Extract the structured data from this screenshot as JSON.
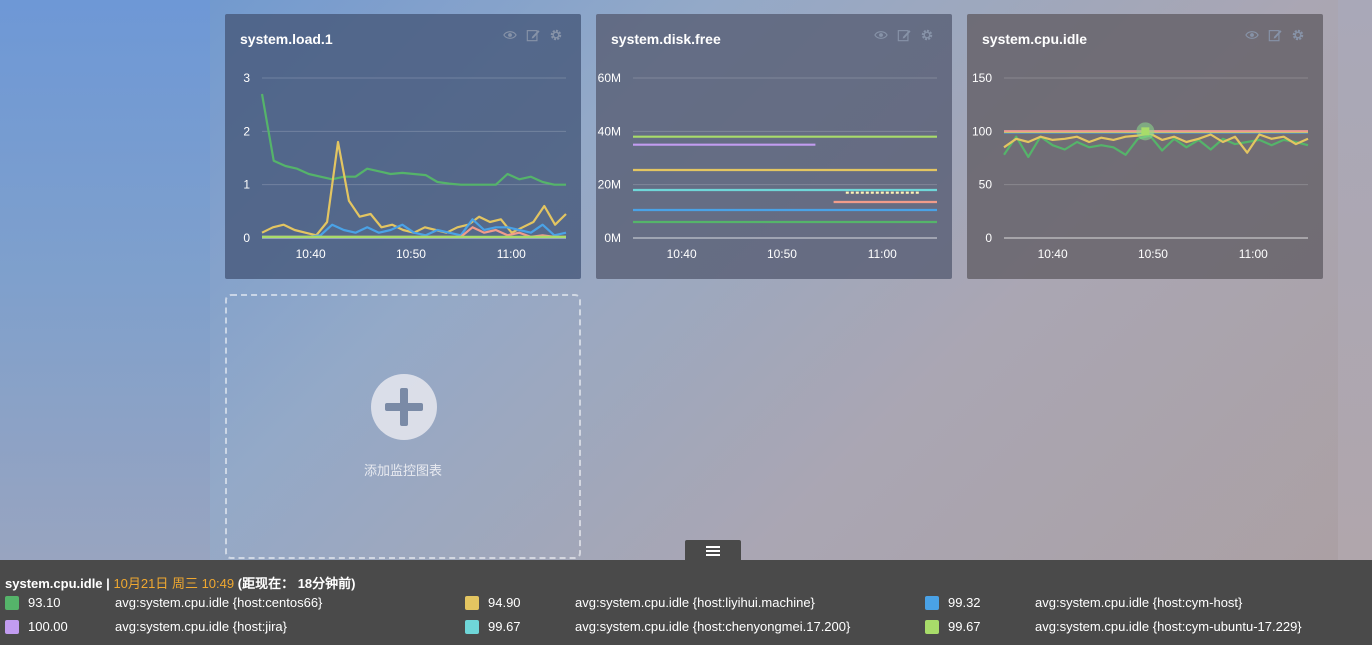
{
  "cards": [
    {
      "title": "system.load.1",
      "chart_data": {
        "type": "line",
        "ylim": [
          0,
          3
        ],
        "yticks": [
          "0",
          "1",
          "2",
          "3"
        ],
        "xticks": [
          "10:40",
          "10:50",
          "11:00"
        ],
        "series": [
          {
            "color": "#55b46a",
            "values": [
              2.7,
              1.45,
              1.35,
              1.3,
              1.2,
              1.15,
              1.1,
              1.15,
              1.15,
              1.3,
              1.25,
              1.2,
              1.22,
              1.2,
              1.18,
              1.05,
              1.02,
              1.0,
              1.0,
              1.0,
              1.0,
              1.2,
              1.1,
              1.15,
              1.05,
              1.0,
              1.0
            ]
          },
          {
            "color": "#e3c561",
            "values": [
              0.1,
              0.2,
              0.25,
              0.15,
              0.1,
              0.05,
              0.3,
              1.8,
              0.7,
              0.4,
              0.45,
              0.2,
              0.25,
              0.15,
              0.1,
              0.2,
              0.15,
              0.1,
              0.2,
              0.25,
              0.4,
              0.3,
              0.35,
              0.1,
              0.2,
              0.3,
              0.6,
              0.25,
              0.45
            ]
          },
          {
            "color": "#4aa2e6",
            "values": [
              0.02,
              0.02,
              0.02,
              0.02,
              0.02,
              0.05,
              0.25,
              0.15,
              0.1,
              0.2,
              0.1,
              0.15,
              0.25,
              0.1,
              0.05,
              0.15,
              0.1,
              0.05,
              0.35,
              0.15,
              0.2,
              0.2,
              0.15,
              0.1,
              0.25,
              0.05,
              0.1
            ]
          },
          {
            "color": "#f19c8a",
            "values": [
              0.02,
              0.02,
              0.02,
              0.02,
              0.02,
              0.02,
              0.02,
              0.02,
              0.02,
              0.02,
              0.02,
              0.02,
              0.02,
              0.02,
              0.02,
              0.02,
              0.02,
              0.02,
              0.2,
              0.1,
              0.15,
              0.05,
              0.1,
              0.02,
              0.05,
              0.02,
              0.02
            ]
          },
          {
            "color": "#a8dc6a",
            "values": [
              0.02,
              0.02,
              0.02,
              0.02,
              0.02,
              0.02,
              0.02,
              0.02,
              0.02,
              0.02,
              0.02,
              0.02,
              0.02,
              0.02,
              0.02,
              0.02,
              0.02,
              0.02,
              0.02,
              0.02,
              0.02,
              0.02,
              0.02,
              0.02,
              0.02,
              0.02,
              0.02
            ]
          }
        ]
      }
    },
    {
      "title": "system.disk.free",
      "chart_data": {
        "type": "line",
        "ylim": [
          0,
          60
        ],
        "yticks": [
          "0M",
          "20M",
          "40M",
          "60M"
        ],
        "xticks": [
          "10:40",
          "10:50",
          "11:00"
        ],
        "series": [
          {
            "color": "#a8dc6a",
            "values": [
              38,
              38
            ]
          },
          {
            "color": "#c29cf0",
            "values": [
              35,
              35
            ],
            "extent": 0.6
          },
          {
            "color": "#e3c561",
            "values": [
              25.5,
              25.5
            ]
          },
          {
            "color": "#6fd6d8",
            "values": [
              18,
              18
            ]
          },
          {
            "color": "#4aa2e6",
            "values": [
              10.5,
              10.5
            ]
          },
          {
            "color": "#55b46a",
            "values": [
              6,
              6
            ]
          },
          {
            "color": "#fff5b8",
            "values": [
              17,
              17
            ],
            "start": 0.7,
            "extent": 0.94,
            "dotted": true
          },
          {
            "color": "#f19c8a",
            "values": [
              13.5,
              13.5
            ],
            "start": 0.66
          }
        ]
      }
    },
    {
      "title": "system.cpu.idle",
      "chart_data": {
        "type": "line",
        "ylim": [
          0,
          150
        ],
        "yticks": [
          "0",
          "50",
          "100",
          "150"
        ],
        "xticks": [
          "10:40",
          "10:50",
          "11:00"
        ],
        "series": [
          {
            "color": "#55b46a",
            "values": [
              78,
              95,
              76,
              95,
              87,
              83,
              90,
              85,
              87,
              85,
              78,
              93,
              96,
              82,
              93,
              85,
              92,
              83,
              93,
              88,
              90,
              92,
              87,
              92,
              90,
              87
            ]
          },
          {
            "color": "#e3c561",
            "values": [
              85,
              93,
              90,
              95,
              92,
              93,
              95,
              90,
              94,
              92,
              95,
              96,
              98,
              92,
              95,
              90,
              93,
              97,
              90,
              95,
              80,
              97,
              93,
              95,
              88,
              93
            ]
          },
          {
            "color": "#4aa2e6",
            "values": [
              99,
              99,
              99,
              99,
              99,
              99,
              99,
              99,
              99,
              99,
              99,
              99,
              99,
              99,
              99,
              99,
              99,
              99,
              99,
              99,
              99,
              99,
              99,
              99
            ]
          },
          {
            "color": "#c29cf0",
            "values": [
              100,
              100,
              100,
              100,
              100,
              100,
              100,
              100,
              100,
              100,
              100,
              100,
              100,
              100,
              100,
              100,
              100,
              100,
              100,
              100,
              100,
              100,
              100,
              100
            ]
          },
          {
            "color": "#6fd6d8",
            "values": [
              99.7,
              99.7,
              99.7,
              99.7,
              99.7,
              99.7,
              99.7,
              99.7,
              99.7,
              99.7,
              99.7,
              99.7
            ]
          },
          {
            "color": "#a8dc6a",
            "values": [
              99.5,
              99.5,
              99.5,
              99.5,
              99.5,
              99.5,
              99.5,
              99.5,
              99.5,
              99.5,
              99.5,
              99.5,
              99.5,
              99.5
            ]
          },
          {
            "color": "#f19c8a",
            "values": [
              100,
              100,
              100,
              100,
              100,
              100,
              100,
              100
            ]
          }
        ]
      }
    }
  ],
  "add_card": {
    "label": "添加监控图表"
  },
  "bottom_panel": {
    "metric": "system.cpu.idle",
    "separator": "|",
    "timestamp": "10月21日 周三 10:49",
    "relative": "(距现在： 18分钟前)",
    "legend": [
      {
        "color": "#55b46a",
        "value": "93.10",
        "name": "avg:system.cpu.idle  {host:centos66}"
      },
      {
        "color": "#e3c561",
        "value": "94.90",
        "name": "avg:system.cpu.idle  {host:liyihui.machine}"
      },
      {
        "color": "#4aa2e6",
        "value": "99.32",
        "name": "avg:system.cpu.idle  {host:cym-host}"
      },
      {
        "color": "#c29cf0",
        "value": "100.00",
        "name": "avg:system.cpu.idle  {host:jira}"
      },
      {
        "color": "#6fd6d8",
        "value": "99.67",
        "name": "avg:system.cpu.idle  {host:chenyongmei.17.200}"
      },
      {
        "color": "#a8dc6a",
        "value": "99.67",
        "name": "avg:system.cpu.idle  {host:cym-ubuntu-17.229}"
      }
    ]
  }
}
